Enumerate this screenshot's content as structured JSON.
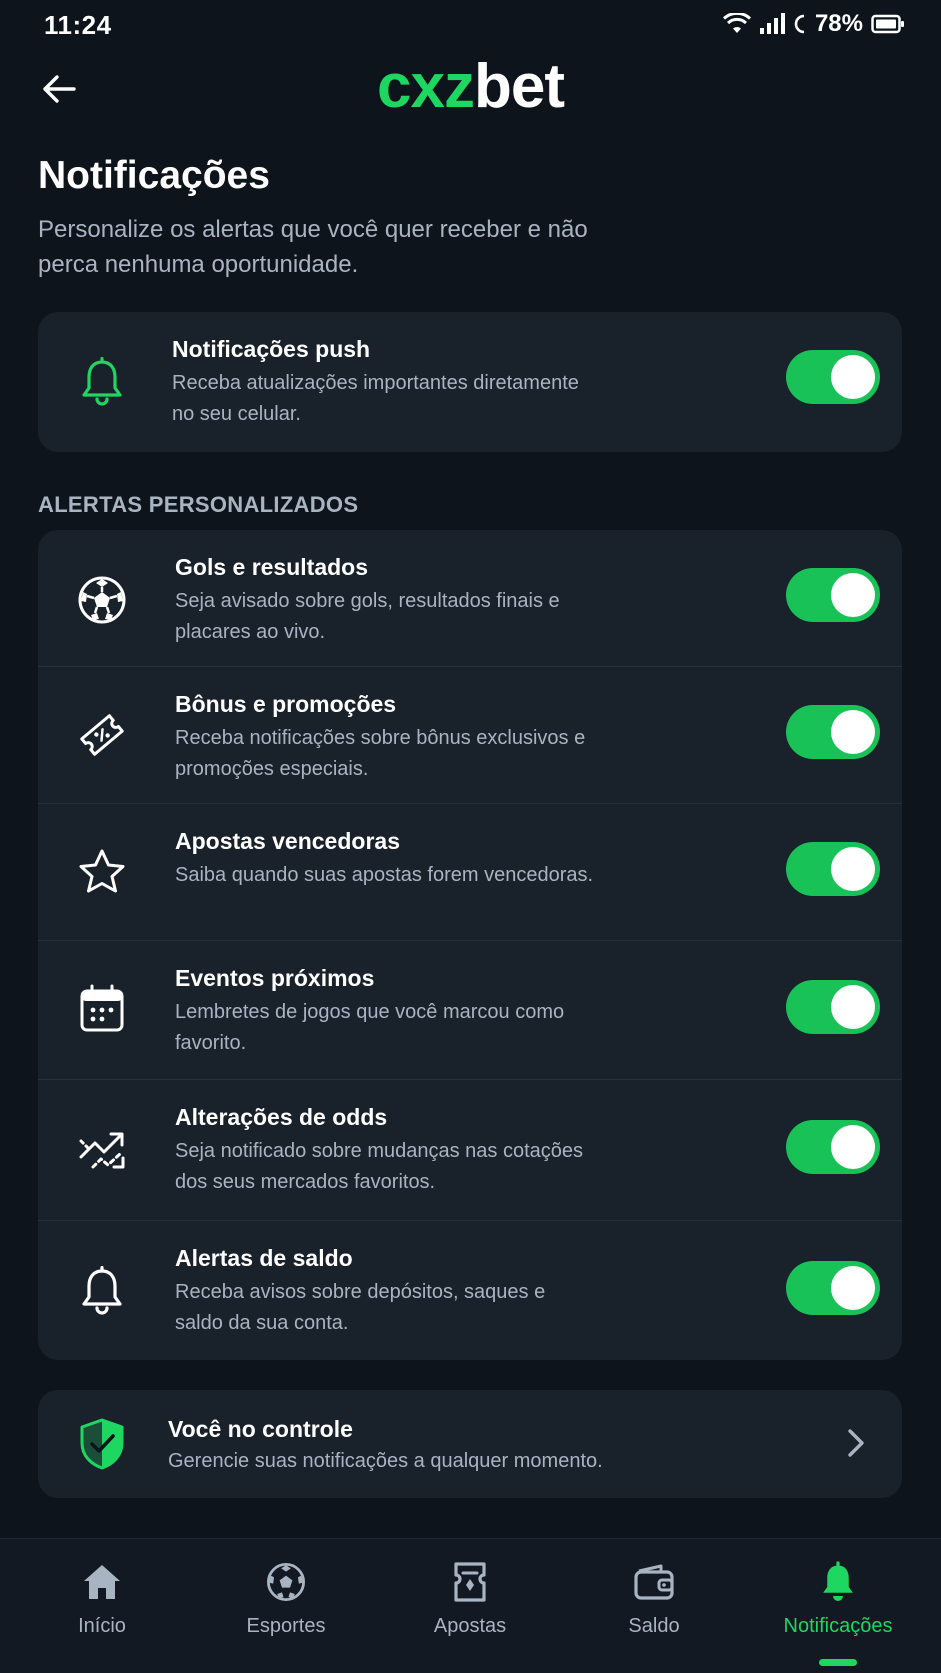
{
  "status_bar": {
    "time": "11:24",
    "battery": "78%"
  },
  "header": {
    "brand_part1": "cxz",
    "brand_part2": "bet",
    "title": "Notificações",
    "subtitle": "Personalize os alertas que você quer receber e não perca nenhuma oportunidade."
  },
  "push": {
    "title": "Notificações push",
    "description": "Receba atualizações importantes diretamente no seu celular.",
    "enabled": true
  },
  "section_label": "ALERTAS PERSONALIZADOS",
  "alerts": [
    {
      "icon": "soccer-ball-icon",
      "title": "Gols e resultados",
      "description": "Seja avisado sobre gols, resultados finais e placares ao vivo.",
      "enabled": true
    },
    {
      "icon": "ticket-percent-icon",
      "title": "Bônus e promoções",
      "description": "Receba notificações sobre bônus exclusivos e promoções especiais.",
      "enabled": true
    },
    {
      "icon": "star-icon",
      "title": "Apostas vencedoras",
      "description": "Saiba quando suas apostas forem vencedoras.",
      "enabled": true
    },
    {
      "icon": "calendar-icon",
      "title": "Eventos próximos",
      "description": "Lembretes de jogos que você marcou como favorito.",
      "enabled": true
    },
    {
      "icon": "trend-arrows-icon",
      "title": "Alterações de odds",
      "description": "Seja notificado sobre mudanças nas cotações dos seus mercados favoritos.",
      "enabled": true
    },
    {
      "icon": "bell-icon",
      "title": "Alertas de saldo",
      "description": "Receba avisos sobre depósitos, saques e saldo da sua conta.",
      "enabled": true
    }
  ],
  "control": {
    "title": "Você no controle",
    "description": "Gerencie suas notificações a qualquer momento."
  },
  "nav": [
    {
      "label": "Início",
      "icon": "home-icon"
    },
    {
      "label": "Esportes",
      "icon": "soccer-ball-icon"
    },
    {
      "label": "Apostas",
      "icon": "bet-slip-icon"
    },
    {
      "label": "Saldo",
      "icon": "wallet-icon"
    },
    {
      "label": "Notificações",
      "icon": "bell-icon",
      "active": true
    }
  ],
  "colors": {
    "accent": "#1ed760",
    "toggle_on": "#19c257",
    "background": "#0e141b",
    "card": "#19212b",
    "muted_text": "#a9b4c2"
  }
}
